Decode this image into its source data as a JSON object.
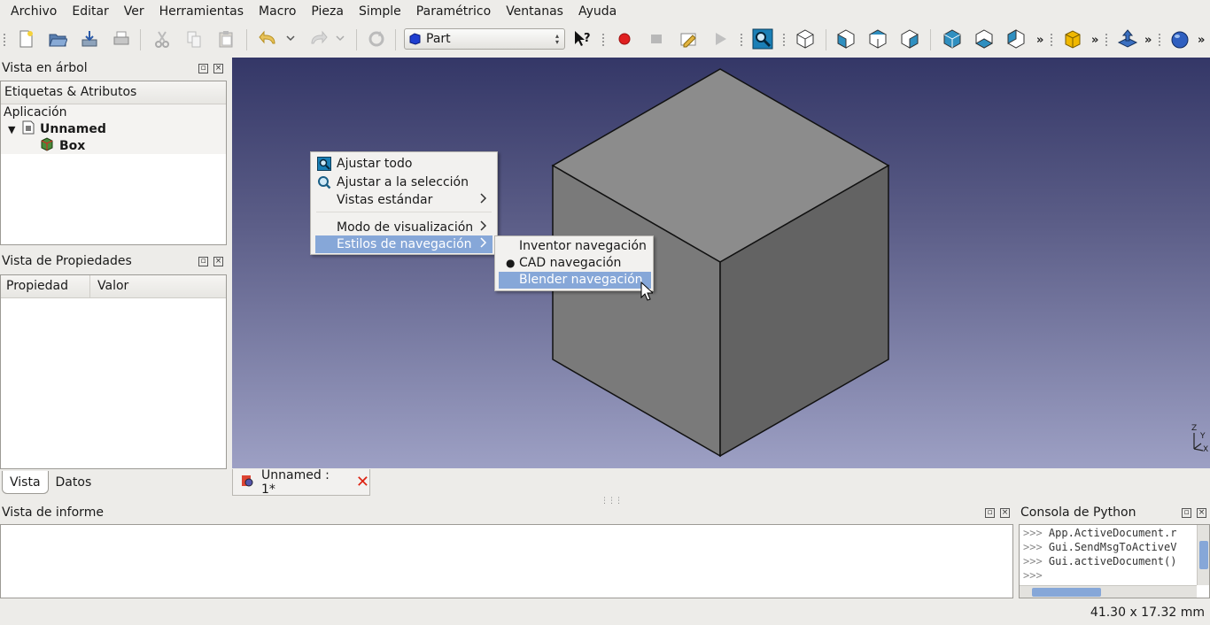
{
  "menubar": [
    {
      "label": "Archivo"
    },
    {
      "label": "Editar"
    },
    {
      "label": "Ver"
    },
    {
      "label": "Herramientas"
    },
    {
      "label": "Macro"
    },
    {
      "label": "Pieza"
    },
    {
      "label": "Simple"
    },
    {
      "label": "Paramétrico"
    },
    {
      "label": "Ventanas"
    },
    {
      "label": "Ayuda"
    }
  ],
  "toolbar": {
    "workbench": "Part",
    "icons": [
      "new-document-icon",
      "open-icon",
      "save-icon",
      "print-icon",
      "cut-icon",
      "copy-icon",
      "paste-icon",
      "undo-icon",
      "redo-icon",
      "refresh-icon",
      "whats-this-icon",
      "record-macro-icon",
      "stop-macro-icon",
      "edit-macro-icon",
      "run-macro-icon",
      "fit-all-icon",
      "isometric-view-icon",
      "front-view-icon",
      "top-view-icon",
      "right-view-icon",
      "rear-view-icon",
      "bottom-view-icon",
      "left-view-icon",
      "box-primitive-icon",
      "extrude-icon",
      "sphere-icon"
    ],
    "overflow": "»"
  },
  "tree_panel": {
    "title": "Vista en árbol",
    "header": "Etiquetas & Atributos",
    "root": "Aplicación",
    "document": "Unnamed",
    "object": "Box"
  },
  "property_panel": {
    "title": "Vista de Propiedades",
    "col_property": "Propiedad",
    "col_value": "Valor",
    "tabs": [
      "Vista",
      "Datos"
    ]
  },
  "view3d": {
    "doc_tab": "Unnamed : 1*",
    "axis_labels": [
      "Z",
      "Y",
      "X"
    ]
  },
  "context_menu": {
    "items": [
      {
        "label": "Ajustar todo"
      },
      {
        "label": "Ajustar a la selección"
      },
      {
        "label": "Vistas estándar",
        "submenu": "›"
      },
      {
        "label": "Modo de visualización",
        "submenu": "›"
      },
      {
        "label": "Estilos de navegación",
        "submenu": "›",
        "highlighted": true
      }
    ],
    "submenu": [
      {
        "label": "Inventor navegación"
      },
      {
        "label": "CAD navegación",
        "checked": true
      },
      {
        "label": "Blender navegación",
        "highlighted": true
      }
    ]
  },
  "report": {
    "title": "Vista de informe"
  },
  "python_console": {
    "title": "Consola de Python",
    "prompt": ">>>",
    "lines": [
      {
        "prompt": ">>>",
        "text": "App.ActiveDocument.r"
      },
      {
        "prompt": ">>>",
        "text": "Gui.SendMsgToActiveV"
      },
      {
        "prompt": ">>>",
        "text": "Gui.activeDocument()"
      },
      {
        "prompt": ">>>",
        "text": ""
      }
    ]
  },
  "statusbar": {
    "text": "41.30 x 17.32 mm"
  },
  "colors": {
    "highlight": "#86a7d8",
    "view_top": "#343767",
    "view_bottom": "#9da0c4",
    "cube_top": "#8c8c8c",
    "cube_left": "#7a7a7a",
    "cube_right": "#636363"
  }
}
